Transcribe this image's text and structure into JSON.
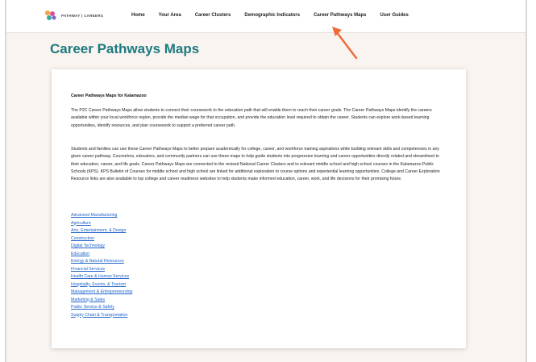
{
  "colors": {
    "accent": "#1d7a80",
    "link": "#1f63c9",
    "arrow": "#ee6b3b",
    "background": "#faf4f0"
  },
  "header": {
    "logo_text": "PATHWAY | CAREERS",
    "nav": [
      "Home",
      "Your Area",
      "Career Clusters",
      "Demographic Indicators",
      "Career Pathways Maps",
      "User Guides"
    ]
  },
  "page": {
    "title": "Career Pathways Maps"
  },
  "card": {
    "heading": "Career Pathways Maps for Kalamazoo",
    "paragraph1": "The P2C Career Pathways Maps allow students to connect their coursework to the education path that will enable them to reach their career goals. The Career Pathways Maps identify the careers available within your local workforce region, provide the median wage for that occupation, and provide the education level required to obtain the career. Students can explore work-based learning opportunities, identify resources, and plan coursework to support a preferred career path.",
    "paragraph2": "Students and families can use these Career Pathways Maps to better prepare academically for college, career, and workforce training aspirations while building relevant skills and competencies in any given career pathway. Counselors, educators, and community partners can use these maps to help guide students into progressive learning and career opportunities directly related and streamlined to their education, career, and life goals. Career Pathways Maps are connected to the revised National Career Clusters and to relevant middle school and high school courses in the Kalamazoo Public Schools (KPS). KPS Bulletin of Courses for middle school and high school are linked for additional exploration to course options and experiential learning opportunities. College and Career Exploration Resource links are also available to top college and career readiness websites to help students make informed education, career, work, and life decisions for their promising future.",
    "links": [
      "Advanced Manufacturing",
      "Agriculture",
      "Arts, Entertainment, & Design",
      "Construction",
      "Digital Technology",
      "Education",
      "Energy & Natural Resources",
      "Financial Services",
      "Health Care & Human Services",
      "Hospitality, Events, & Tourism",
      "Management & Entrepreneurship",
      "Marketing & Sales",
      "Public Service & Safety",
      "Supply Chain & Transportation"
    ]
  }
}
